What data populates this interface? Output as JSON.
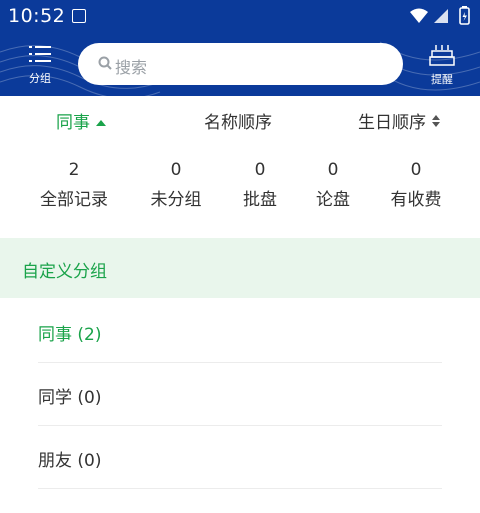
{
  "status_bar": {
    "time": "10:52"
  },
  "header": {
    "groups_label": "分组",
    "search_placeholder": "搜索",
    "remind_label": "提醒"
  },
  "sort": {
    "options": [
      "同事",
      "名称顺序",
      "生日顺序"
    ],
    "active_index": 0
  },
  "stats": [
    {
      "count": "2",
      "label": "全部记录"
    },
    {
      "count": "0",
      "label": "未分组"
    },
    {
      "count": "0",
      "label": "批盘"
    },
    {
      "count": "0",
      "label": "论盘"
    },
    {
      "count": "0",
      "label": "有收费"
    }
  ],
  "section_title": "自定义分组",
  "groups": [
    {
      "label": "同事 (2)",
      "active": true
    },
    {
      "label": "同学 (0)",
      "active": false
    },
    {
      "label": "朋友 (0)",
      "active": false
    }
  ],
  "colors": {
    "header_bg": "#0b3a9a",
    "accent": "#1aa34a",
    "section_bg": "#e9f6ec"
  }
}
